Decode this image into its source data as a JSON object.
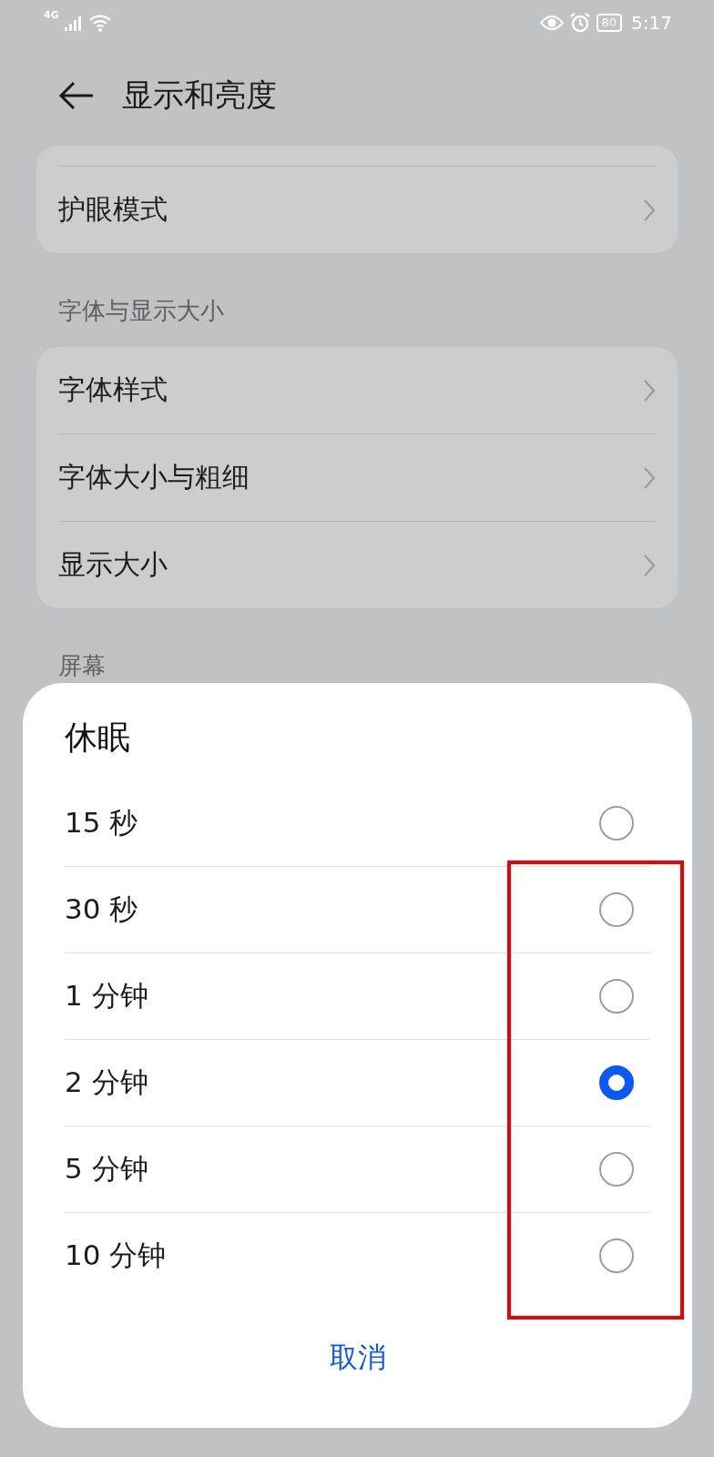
{
  "status_bar": {
    "network": "4G",
    "battery": "80",
    "time": "5:17"
  },
  "header": {
    "title": "显示和亮度"
  },
  "groups": [
    {
      "items": [
        {
          "label": "护眼模式"
        }
      ]
    },
    {
      "title": "字体与显示大小",
      "items": [
        {
          "label": "字体样式"
        },
        {
          "label": "字体大小与粗细"
        },
        {
          "label": "显示大小"
        }
      ]
    }
  ],
  "covered_section": {
    "title": "屏幕"
  },
  "dialog": {
    "title": "休眠",
    "options": [
      {
        "label": "15 秒",
        "selected": false
      },
      {
        "label": "30 秒",
        "selected": false
      },
      {
        "label": "1 分钟",
        "selected": false
      },
      {
        "label": "2 分钟",
        "selected": true
      },
      {
        "label": "5 分钟",
        "selected": false
      },
      {
        "label": "10 分钟",
        "selected": false
      }
    ],
    "cancel": "取消"
  }
}
